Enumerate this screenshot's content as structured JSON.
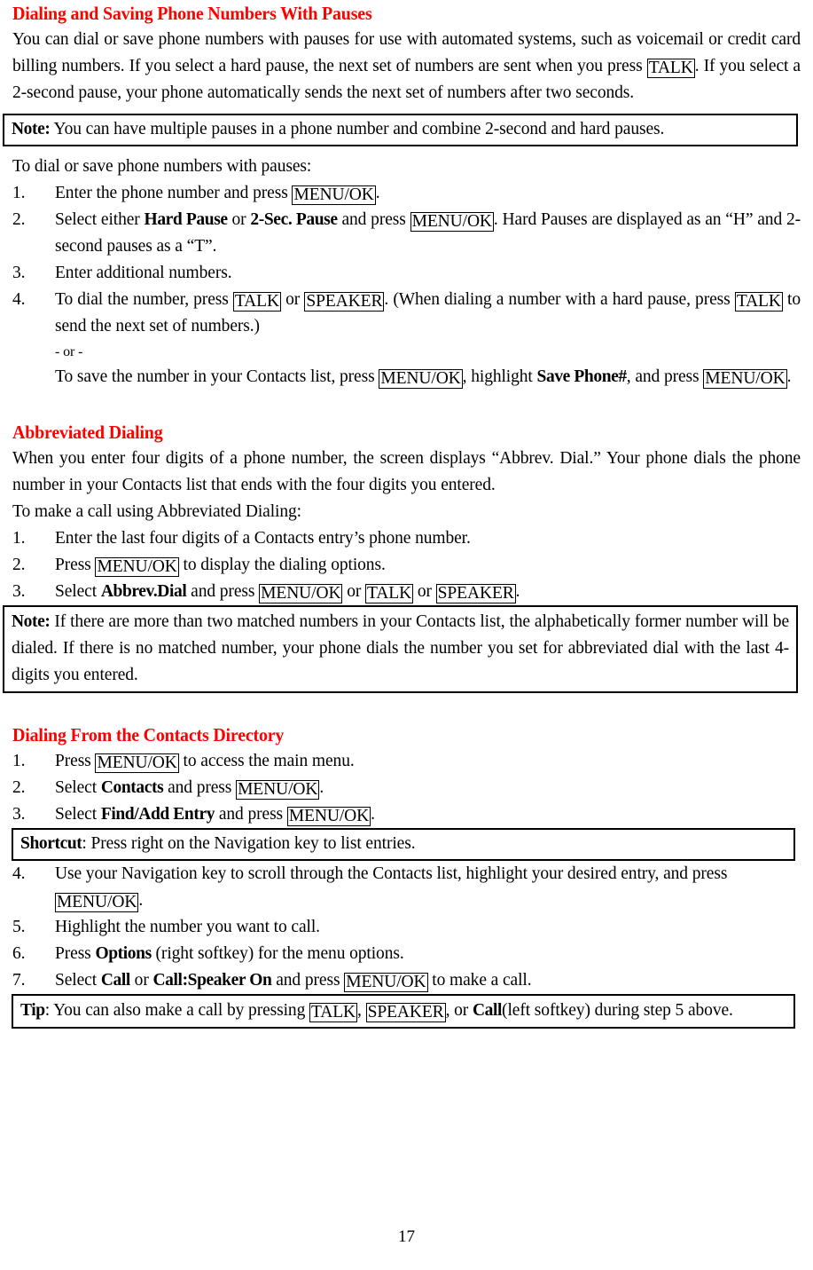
{
  "document": {
    "page_number": "17"
  },
  "sections": [
    {
      "heading": "Dialing and Saving Phone Numbers With Pauses",
      "intro": {
        "p1_a": "You can dial or save phone numbers with pauses for use with automated systems, such as voicemail or credit card billing numbers. If you select a hard pause, the next set of numbers are sent when you press ",
        "p1_key": "TALK",
        "p1_b": ". If you select a 2-second pause, your phone automatically sends the next set of numbers after two seconds."
      },
      "note": {
        "lead": "Note:",
        "text": " You can have multiple pauses in a phone number and combine 2-second and hard pauses."
      },
      "lead_in": "To dial or save phone numbers with pauses:",
      "steps": [
        {
          "num": "1.",
          "a": "Enter the phone number and press ",
          "key1": "MENU/OK",
          "b": "."
        },
        {
          "num": "2.",
          "a": "Select either ",
          "term1": "Hard Pause",
          "b": " or ",
          "term2": "2-Sec. Pause",
          "c": " and press ",
          "key1": "MENU/OK",
          "d": ". Hard Pauses are displayed as an “H” and 2-second pauses as a “T”."
        },
        {
          "num": "3.",
          "a": "Enter additional numbers."
        },
        {
          "num": "4.",
          "a": "To dial the number, press ",
          "key1": "TALK",
          "b": " or ",
          "key2": "SPEAKER",
          "c": ". (When dialing a number with a hard pause, press ",
          "key3": "TALK",
          "d": " to send the next set of numbers.)",
          "or_line": "- or -",
          "sub_a": "To save the number in your Contacts list, press ",
          "sub_key1": "MENU/OK",
          "sub_b": ", highlight ",
          "sub_term": "Save Phone#",
          "sub_c": ", and press ",
          "sub_key2": "MENU/OK",
          "sub_d": "."
        }
      ]
    },
    {
      "heading": "Abbreviated Dialing",
      "intro": {
        "p1": "When you enter four digits of a phone number, the screen displays “Abbrev. Dial.” Your phone dials the phone number in your Contacts list that ends with the four digits you entered."
      },
      "lead_in": "To make a call using Abbreviated Dialing:",
      "steps": [
        {
          "num": "1.",
          "a": "Enter the last four digits of a Contacts entry’s phone number."
        },
        {
          "num": "2.",
          "a": "Press ",
          "key1": "MENU/OK",
          "b": " to display the dialing options."
        },
        {
          "num": "3.",
          "a": "Select ",
          "term1": "Abbrev.Dial",
          "b": " and press ",
          "key1": "MENU/OK",
          "c": " or ",
          "key2": "TALK",
          "d": " or ",
          "key3": "SPEAKER",
          "e": "."
        }
      ],
      "note": {
        "lead": "Note:",
        "text": " If there are more than two matched numbers in your Contacts list, the alphabetically former number will be dialed. If there is no matched number, your phone dials the number you set for abbreviated dial with the last 4-digits you entered."
      }
    },
    {
      "heading": "Dialing From the Contacts Directory",
      "steps_top": [
        {
          "num": "1.",
          "a": "Press ",
          "key1": "MENU/OK",
          "b": " to access the main menu."
        },
        {
          "num": "2.",
          "a": "Select ",
          "term1": "Contacts",
          "b": " and press ",
          "key1": "MENU/OK",
          "c": "."
        },
        {
          "num": "3.",
          "a": "Select ",
          "term1": "Find/Add Entry",
          "b": " and press ",
          "key1": "MENU/OK",
          "c": "."
        }
      ],
      "shortcut": {
        "lead": "Shortcut",
        "text": ": Press right on the Navigation key to list entries."
      },
      "steps_bottom": [
        {
          "num": "4.",
          "a": "Use your Navigation key to scroll through the Contacts list, highlight your desired entry, and press ",
          "key1": "MENU/OK",
          "b": "."
        },
        {
          "num": "5.",
          "a": "Highlight the number you want to call."
        },
        {
          "num": "6.",
          "a": "Press ",
          "term1": "Options",
          "b": " (right softkey) for the menu options."
        },
        {
          "num": "7.",
          "a": "Select ",
          "term1": "Call",
          "b": " or ",
          "term2": "Call:Speaker On",
          "c": " and press ",
          "key1": "MENU/OK",
          "d": " to make a call."
        }
      ],
      "tip": {
        "lead": "Tip",
        "a": ": You can also make a call by pressing ",
        "key1": "TALK",
        "b": ", ",
        "key2": "SPEAKER",
        "c": ", or ",
        "term1": "Call",
        "d": "(left softkey) during step 5 above."
      }
    }
  ],
  "colors": {
    "heading": "#FF0000",
    "text": "#000000"
  }
}
